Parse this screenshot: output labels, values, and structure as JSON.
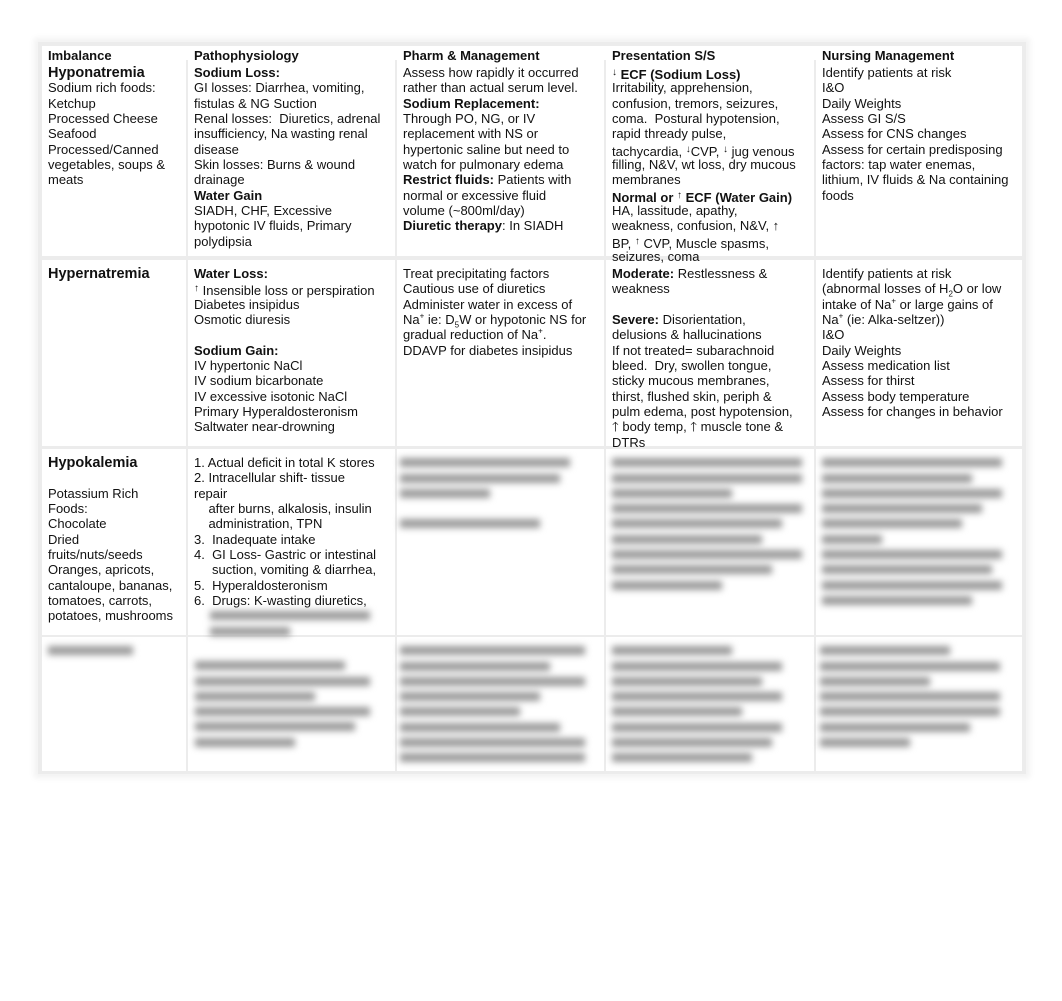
{
  "header": [
    "Imbalance",
    "Pathophysiology",
    "Pharm & Management",
    "Presentation S/S",
    "Nursing Management"
  ],
  "rows": [
    {
      "cells": [
        [
          [
            {
              "t": "Hyponatremia",
              "c": "big"
            }
          ],
          "Sodium rich foods:",
          "Ketchup",
          "Processed Cheese",
          "Seafood",
          "Processed/Canned",
          "vegetables, soups &",
          "meats"
        ],
        [
          [
            {
              "t": "Sodium Loss:",
              "c": "b"
            }
          ],
          "GI losses: Diarrhea, vomiting,",
          "fistulas & NG Suction",
          "Renal losses:  Diuretics, adrenal",
          "insufficiency, Na wasting renal",
          "disease",
          "Skin losses: Burns & wound",
          "drainage",
          [
            {
              "t": "Water Gain",
              "c": "b"
            }
          ],
          "SIADH, CHF, Excessive",
          "hypotonic IV fluids, Primary",
          "polydipsia"
        ],
        [
          "Assess how rapidly it occurred",
          "rather than actual serum level.",
          [
            {
              "t": "Sodium Replacement:",
              "c": "b"
            }
          ],
          "Through PO, NG, or IV",
          "replacement with NS or",
          "hypertonic saline but need to",
          "watch for pulmonary edema",
          [
            {
              "t": "Restrict fluids:",
              "c": "b"
            },
            {
              "t": " Patients with"
            }
          ],
          "normal or excessive fluid",
          "volume (~800ml/day)",
          [
            {
              "t": "Diuretic therapy",
              "c": "b"
            },
            {
              "t": ": In SIADH"
            }
          ]
        ],
        [
          [
            {
              "t": "↓",
              "c": "arr"
            },
            {
              "t": " ECF (Sodium Loss)",
              "c": "b"
            }
          ],
          "Irritability, apprehension,",
          "confusion, tremors, seizures,",
          "coma.  Postural hypotension,",
          "rapid thready pulse,",
          [
            {
              "t": "tachycardia, "
            },
            {
              "t": "↓",
              "c": "arr"
            },
            {
              "t": "CVP, "
            },
            {
              "t": "↓",
              "c": "arr"
            },
            {
              "t": " jug venous"
            }
          ],
          "filling, N&V, wt loss, dry mucous",
          "membranes",
          [
            {
              "t": "Normal or ",
              "c": "b"
            },
            {
              "t": "↑",
              "c": "arr"
            },
            {
              "t": " ECF (Water Gain)",
              "c": "b"
            }
          ],
          "HA, lassitude, apathy,",
          "weakness, confusion, N&V, ↑",
          [
            {
              "t": "BP, "
            },
            {
              "t": "↑",
              "c": "arr"
            },
            {
              "t": " CVP, Muscle spasms,"
            }
          ],
          "seizures, coma"
        ],
        [
          "Identify patients at risk",
          "I&O",
          "Daily Weights",
          "Assess GI S/S",
          "Assess for CNS changes",
          "Assess for certain predisposing",
          "factors: tap water enemas,",
          "lithium, IV fluids & Na containing",
          "foods"
        ]
      ]
    },
    {
      "cells": [
        [
          [
            {
              "t": "Hypernatremia",
              "c": "big"
            }
          ]
        ],
        [
          [
            {
              "t": "Water Loss:",
              "c": "b"
            }
          ],
          [
            {
              "t": "↑",
              "c": "arr"
            },
            {
              "t": " Insensible loss or perspiration"
            }
          ],
          "Diabetes insipidus",
          "Osmotic diuresis",
          "",
          [
            {
              "t": "Sodium Gain:",
              "c": "b"
            }
          ],
          "IV hypertonic NaCl",
          "IV sodium bicarbonate",
          "IV excessive isotonic NaCl",
          "Primary Hyperaldosteronism",
          "Saltwater near-drowning"
        ],
        [
          "Treat precipitating factors",
          "Cautious use of diuretics",
          "Administer water in excess of",
          [
            {
              "t": "Na"
            },
            {
              "t": "+",
              "c": "sup"
            },
            {
              "t": " ie: D"
            },
            {
              "t": "5",
              "c": "sub"
            },
            {
              "t": "W or hypotonic NS for"
            }
          ],
          [
            {
              "t": "gradual reduction of Na"
            },
            {
              "t": "+",
              "c": "sup"
            },
            {
              "t": "."
            }
          ],
          "DDAVP for diabetes insipidus"
        ],
        [
          [
            {
              "t": "Moderate:",
              "c": "b"
            },
            {
              "t": " Restlessness &"
            }
          ],
          "weakness",
          "",
          [
            {
              "t": "Severe:",
              "c": "b"
            },
            {
              "t": " Disorientation,"
            }
          ],
          "delusions & hallucinations",
          "If not treated= subarachnoid",
          "bleed.  Dry, swollen tongue,",
          "sticky mucous membranes,",
          "thirst, flushed skin, periph &",
          "pulm edema, post hypotension,",
          "🡑 body temp, 🡑 muscle tone &",
          "DTRs"
        ],
        [
          "Identify patients at risk",
          [
            {
              "t": "(abnormal losses of H"
            },
            {
              "t": "2",
              "c": "sub"
            },
            {
              "t": "O or low"
            }
          ],
          [
            {
              "t": "intake of Na"
            },
            {
              "t": "+",
              "c": "sup"
            },
            {
              "t": " or large gains of"
            }
          ],
          [
            {
              "t": "Na"
            },
            {
              "t": "+",
              "c": "sup"
            },
            {
              "t": " (ie: Alka-seltzer))"
            }
          ],
          "I&O",
          "Daily Weights",
          "Assess medication list",
          "Assess for thirst",
          "Assess body temperature",
          "Assess for changes in behavior"
        ]
      ]
    },
    {
      "cells": [
        [
          [
            {
              "t": "Hypokalemia",
              "c": "big"
            }
          ],
          "",
          "Potassium Rich",
          "Foods:",
          "Chocolate",
          "Dried",
          "fruits/nuts/seeds",
          "Oranges, apricots,",
          "cantaloupe, bananas,",
          "tomatoes, carrots,",
          "potatoes, mushrooms"
        ],
        [
          "1. Actual deficit in total K stores",
          "2. Intracellular shift- tissue",
          "repair",
          "    after burns, alkalosis, insulin",
          "    administration, TPN",
          "3.  Inadequate intake",
          "4.  GI Loss- Gastric or intestinal",
          "     suction, vomiting & diarrhea,",
          "5.  Hyperaldosteronism",
          "6.  Drugs: K-wasting diuretics,"
        ]
      ]
    }
  ]
}
